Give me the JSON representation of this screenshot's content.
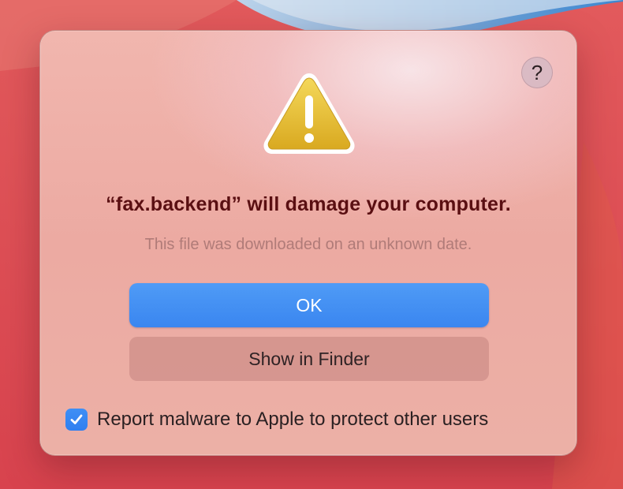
{
  "dialog": {
    "title": "“fax.backend” will damage your computer.",
    "subtitle": "This file was downloaded on an unknown date.",
    "help_label": "?",
    "primary_button": "OK",
    "secondary_button": "Show in Finder",
    "report_checkbox": {
      "label": "Report malware to Apple to protect other users",
      "checked": true
    },
    "icon": "warning-icon"
  },
  "colors": {
    "dialog_bg": "#ecaaa2",
    "title": "#5a0f12",
    "subtitle": "#b07b78",
    "accent": "#3a86f0",
    "secondary_button_bg": "#d2928c",
    "wallpaper_red": "#d9464f",
    "wallpaper_blue": "#4a90d0"
  }
}
